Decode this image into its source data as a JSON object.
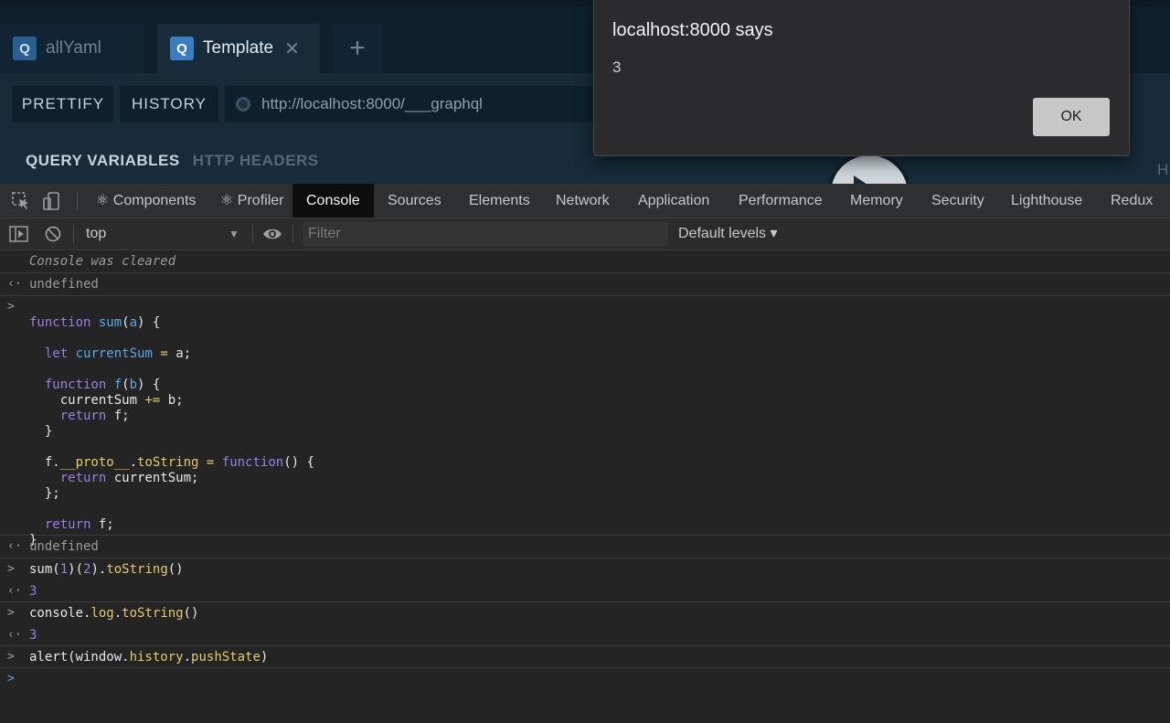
{
  "playground": {
    "tabs": [
      {
        "icon": "Q",
        "label": "allYaml",
        "active": false
      },
      {
        "icon": "Q",
        "label": "Template",
        "active": true,
        "close": "✕"
      }
    ],
    "add_tab": "+",
    "prettify": "PRETTIFY",
    "history": "HISTORY",
    "endpoint": "http://localhost:8000/___graphql",
    "query_variables": "QUERY VARIABLES",
    "http_headers": "HTTP HEADERS",
    "right_edge_letter": "H"
  },
  "alert": {
    "title": "localhost:8000 says",
    "message": "3",
    "ok": "OK"
  },
  "devtools": {
    "tabs": [
      "⚛ Components",
      "⚛ Profiler",
      "Console",
      "Sources",
      "Elements",
      "Network",
      "Application",
      "Performance",
      "Memory",
      "Security",
      "Lighthouse",
      "Redux"
    ],
    "active_tab": "Console",
    "context": "top",
    "filter_placeholder": "Filter",
    "levels": "Default levels ▾"
  },
  "console": {
    "cleared": "Console was cleared",
    "undefined1": "undefined",
    "undefined2": "undefined",
    "code": [
      "function sum(a) {",
      "",
      "  let currentSum = a;",
      "",
      "  function f(b) {",
      "    currentSum += b;",
      "    return f;",
      "  }",
      "",
      "  f.__proto__.toString = function() {",
      "    return currentSum;",
      "  };",
      "",
      "  return f;",
      "}"
    ],
    "cmd1": "sum(1)(2).toString()",
    "res1": "3",
    "cmd2": "console.log.toString()",
    "res2": "3",
    "cmd3": "alert(window.history.pushState)"
  }
}
